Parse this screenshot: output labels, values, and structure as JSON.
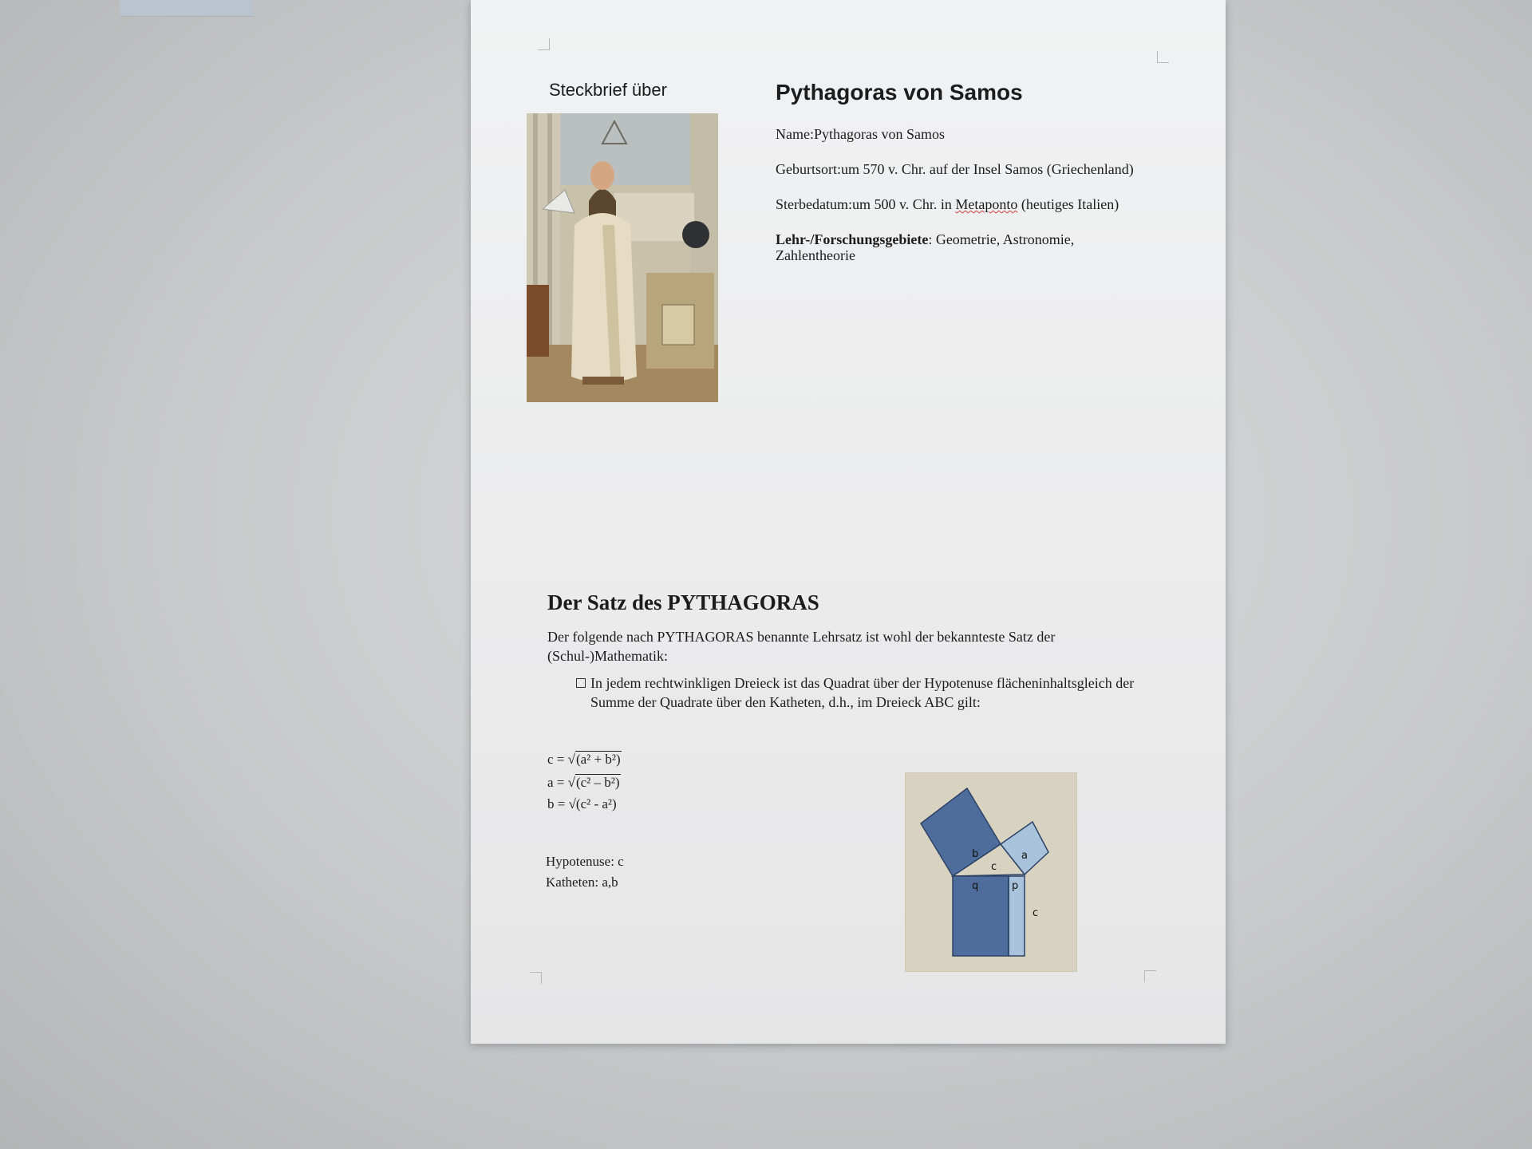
{
  "header": {
    "left_label": "Steckbrief über",
    "title": "Pythagoras von Samos"
  },
  "info": {
    "name": "Name:Pythagoras von Samos",
    "birth": "Geburtsort:um 570 v. Chr. auf der Insel Samos (Griechenland)",
    "death_prefix": "Sterbedatum:um 500 v. Chr. in ",
    "death_place": "Metaponto",
    "death_suffix": " (heutiges Italien)",
    "fields_label": "Lehr-/Forschungsgebiete",
    "fields_value": ": Geometrie, Astronomie, Zahlentheorie"
  },
  "section": {
    "heading": "Der Satz des PYTHAGORAS",
    "intro": "Der folgende nach PYTHAGORAS benannte Lehrsatz ist wohl der bekannteste Satz der (Schul-)Mathematik:",
    "bullet": "In jedem rechtwinkligen Dreieck ist das Quadrat über der Hypotenuse flächeninhaltsgleich der Summe der Quadrate über den Katheten, d.h., im Dreieck ABC gilt:"
  },
  "formulas": {
    "f1_lhs": "c = √",
    "f1_rad": "(a² + b²)",
    "f2_lhs": "a = √",
    "f2_rad": "(c² – b²)",
    "f3_lhs": "b = √",
    "f3_rad": "(c² - a²)"
  },
  "legend": {
    "hypotenuse": "Hypotenuse: c",
    "katheten": "Katheten: a,b"
  },
  "diagram_labels": {
    "b": "b",
    "a": "a",
    "c_top": "c",
    "q": "q",
    "p": "p",
    "c_side": "c"
  },
  "colors": {
    "dark_blue": "#4f6d9c",
    "light_blue": "#a9c3dc",
    "beige": "#d8d2c1"
  }
}
